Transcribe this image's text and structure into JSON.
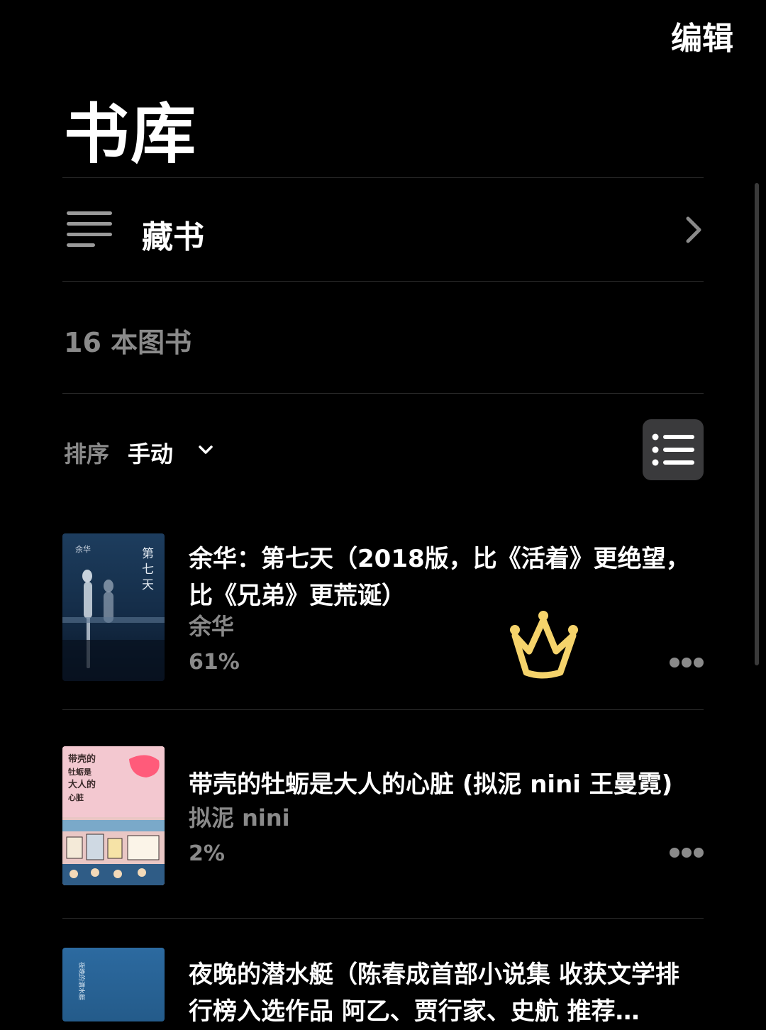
{
  "header": {
    "edit_label": "编辑",
    "title": "书库"
  },
  "collection": {
    "label": "藏书",
    "icon": "list-icon"
  },
  "summary": {
    "book_count": "16 本图书"
  },
  "sort": {
    "label": "排序",
    "value": "手动"
  },
  "books": [
    {
      "title": "余华：第七天（2018版，比《活着》更绝望，比《兄弟》更荒诞）",
      "author": "余华",
      "progress": "61%",
      "cover_text": [
        "余华",
        "第",
        "七",
        "天"
      ]
    },
    {
      "title": "带壳的牡蛎是大人的心脏 (拟泥 nini 王曼霓)",
      "author": "拟泥 nini",
      "progress": "2%",
      "cover_text": [
        "带壳的",
        "牡蛎是",
        "大人的",
        "心脏"
      ]
    },
    {
      "title": "夜晚的潜水艇（陈春成首部小说集 收获文学排行榜入选作品 阿乙、贾行家、史航 推荐…",
      "cover_text": [
        "夜晚的潜水艇"
      ]
    }
  ],
  "colors": {
    "background": "#000000",
    "secondary_text": "#8a8a8a",
    "crown": "#f5d36b"
  }
}
